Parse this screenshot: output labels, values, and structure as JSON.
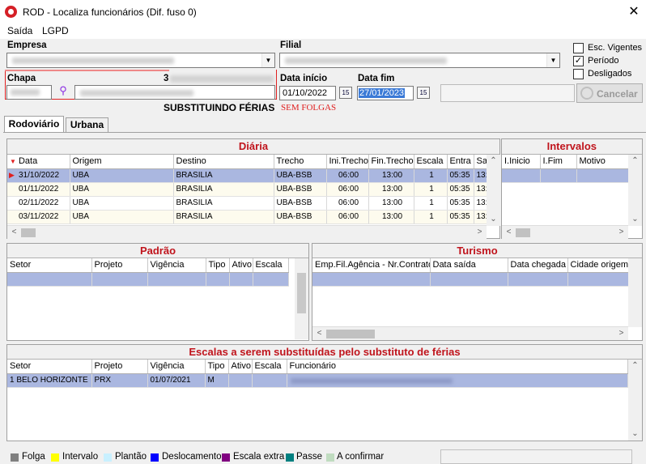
{
  "window": {
    "title": "ROD - Localiza funcionários (Dif. fuso 0)",
    "close_icon": "close-icon"
  },
  "menu": [
    "Saída",
    "LGPD"
  ],
  "empresa": {
    "label": "Empresa"
  },
  "filial": {
    "label": "Filial"
  },
  "chapa": {
    "label": "Chapa",
    "code_prefix": "3"
  },
  "data_inicio": {
    "label": "Data início",
    "value": "01/10/2022"
  },
  "data_fim": {
    "label": "Data fim",
    "value": "27/01/2023"
  },
  "cal_btn": "15",
  "options": {
    "esc_vigentes": "Esc. Vigentes",
    "periodo": "Período",
    "desligados": "Desligados"
  },
  "cancel": "Cancelar",
  "status": {
    "main": "SUBSTITUINDO FÉRIAS",
    "sub": "SEM FOLGAS"
  },
  "tabs": [
    "Rodoviário",
    "Urbana"
  ],
  "diaria": {
    "title": "Diária",
    "columns": [
      "Data",
      "Origem",
      "Destino",
      "Trecho",
      "Ini.Trecho",
      "Fin.Trecho",
      "Escala",
      "Entra",
      "Sa"
    ],
    "rows": [
      [
        "31/10/2022",
        "UBA",
        "BRASILIA",
        "UBA-BSB",
        "06:00",
        "13:00",
        "1",
        "05:35",
        "13:"
      ],
      [
        "01/11/2022",
        "UBA",
        "BRASILIA",
        "UBA-BSB",
        "06:00",
        "13:00",
        "1",
        "05:35",
        "13:"
      ],
      [
        "02/11/2022",
        "UBA",
        "BRASILIA",
        "UBA-BSB",
        "06:00",
        "13:00",
        "1",
        "05:35",
        "13:"
      ],
      [
        "03/11/2022",
        "UBA",
        "BRASILIA",
        "UBA-BSB",
        "06:00",
        "13:00",
        "1",
        "05:35",
        "13:"
      ]
    ]
  },
  "intervalos": {
    "title": "Intervalos",
    "columns": [
      "I.Inicio",
      "I.Fim",
      "Motivo"
    ]
  },
  "padrao": {
    "title": "Padrão",
    "columns": [
      "Setor",
      "Projeto",
      "Vigência",
      "Tipo",
      "Ativo",
      "Escala"
    ]
  },
  "turismo": {
    "title": "Turismo",
    "columns": [
      "Emp.Fil.Agência - Nr.Contrato",
      "Data saída",
      "Data chegada",
      "Cidade origem"
    ]
  },
  "escalas": {
    "title": "Escalas a serem substituídas pelo substituto de férias",
    "columns": [
      "Setor",
      "Projeto",
      "Vigência",
      "Tipo",
      "Ativo",
      "Escala",
      "Funcionário"
    ],
    "rows": [
      [
        "1 BELO HORIZONTE",
        "PRX",
        "01/07/2021",
        "M",
        "",
        "",
        ""
      ]
    ]
  },
  "legend": [
    {
      "label": "Folga",
      "color": "#808080"
    },
    {
      "label": "Intervalo",
      "color": "#ffff00"
    },
    {
      "label": "Plantão",
      "color": "#c8f0ff"
    },
    {
      "label": "Deslocamento",
      "color": "#0000ff"
    },
    {
      "label": "Escala extra",
      "color": "#800080"
    },
    {
      "label": "Passe",
      "color": "#008080"
    },
    {
      "label": "A confirmar",
      "color": "#c0dcc0"
    }
  ]
}
